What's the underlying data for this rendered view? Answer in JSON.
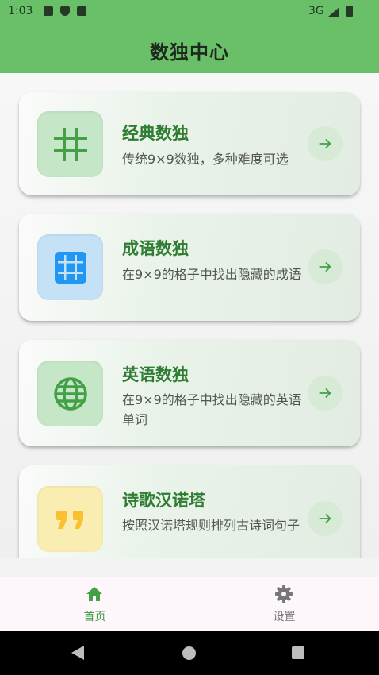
{
  "status_bar": {
    "time": "1:03",
    "network": "3G",
    "icons": [
      "text-icon",
      "shield-icon",
      "sd-card-icon",
      "signal-icon",
      "battery-icon"
    ]
  },
  "app_bar": {
    "title": "数独中心"
  },
  "cards": [
    {
      "title": "经典数独",
      "description": "传统9×9数独，多种难度可选",
      "icon": "grid-hash-icon",
      "icon_color": "#43a047",
      "icon_bg": "#c6e6c8"
    },
    {
      "title": "成语数独",
      "description": "在9×9的格子中找出隐藏的成语",
      "icon": "apps-grid-icon",
      "icon_color": "#2196f3",
      "icon_bg": "#c4e1f6"
    },
    {
      "title": "英语数独",
      "description": "在9×9的格子中找出隐藏的英语单词",
      "icon": "globe-icon",
      "icon_color": "#43a047",
      "icon_bg": "#c6e6c8"
    },
    {
      "title": "诗歌汉诺塔",
      "description": "按照汉诺塔规则排列古诗词句子",
      "icon": "quote-icon",
      "icon_color": "#fbc02d",
      "icon_bg": "#faedb1"
    }
  ],
  "bottom_nav": {
    "items": [
      {
        "label": "首页",
        "icon": "home-icon",
        "selected": true
      },
      {
        "label": "设置",
        "icon": "gear-icon",
        "selected": false
      }
    ]
  },
  "colors": {
    "primary": "#6abf69",
    "title_green": "#2f7d32",
    "accent_green": "#43a047",
    "accent_blue": "#2196f3",
    "accent_yellow": "#fbc02d"
  }
}
